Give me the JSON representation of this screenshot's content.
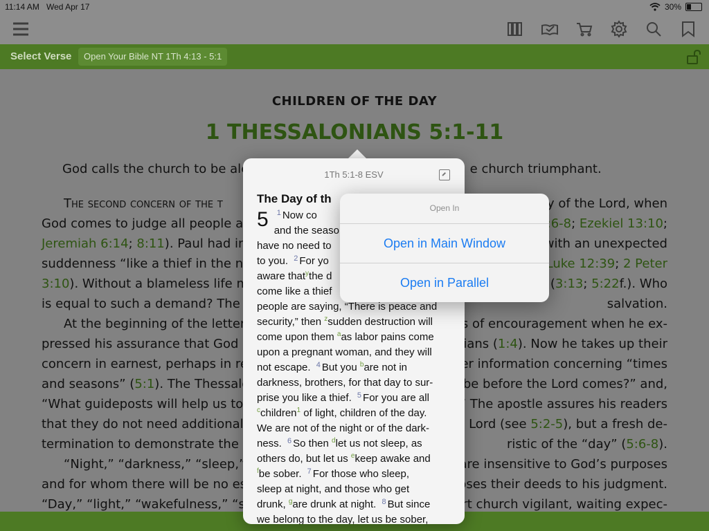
{
  "status": {
    "time": "11:14 AM",
    "date": "Wed Apr 17",
    "battery": "30%",
    "battery_fraction": 0.3
  },
  "toolbar": {
    "icons": [
      "menu-icon",
      "library-icon",
      "reading-plan-icon",
      "cart-icon",
      "gear-icon",
      "search-icon",
      "bookmark-icon"
    ]
  },
  "greenbar": {
    "label": "Select Verse",
    "pill": "Open Your Bible NT 1Th 4:13 - 5:1"
  },
  "content": {
    "kicker": "CHILDREN OF THE DAY",
    "title": "1 THESSALONIANS 5:1-11",
    "intro_left": "God calls the church to be aler",
    "intro_right": "e church triumphant.",
    "p1_lines": [
      [
        "The second concern of the t",
        "y of the Lord, when"
      ],
      [
        "God comes to judge all people a",
        "3:6-8; Ezekiel 13:10;"
      ],
      [
        "Jeremiah 6:14; 8:11). Paul had ins",
        "with an unexpected"
      ],
      [
        "suddenness “like a thief in the ni",
        "Luke 12:39; 2 Peter"
      ],
      [
        "3:10). Without a blameless life me",
        "d (3:13; 5:22f.). Who"
      ],
      [
        "is equal to such a demand? The fa",
        "salvation."
      ]
    ],
    "p2_lines": [
      [
        "At the beginning of the letter P",
        "ds of encouragement when he ex-"
      ],
      [
        "pressed his assurance that God l",
        "ians (1:4). Now he takes up their"
      ],
      [
        "concern in earnest, perhaps in res",
        "er information concerning “times"
      ],
      [
        "and seasons” (5:1). The Thessalo",
        " be before the Lord comes?” and,"
      ],
      [
        "“What guideposts will help us to r",
        "?” The apostle assures his readers"
      ],
      [
        "that they do not need additional",
        "e Lord (see 5:2-5), but a fresh de-"
      ],
      [
        "termination to demonstrate the w",
        "ristic of the “day” (5:6-8)."
      ]
    ],
    "p3_lines": [
      [
        "“Night,” “darkness,” “sleep,” ",
        "are insensitive to God’s purposes"
      ],
      [
        "and for whom there will be no es",
        "oses their deeds to his judgment."
      ],
      [
        "“Day,” “light,” “wakefulness,” “so",
        "rt church vigilant, waiting expec-"
      ]
    ]
  },
  "popover": {
    "title": "1Th 5:1-8 ESV",
    "heading": "The Day of th",
    "chapter": "5",
    "text_html_lines": []
  },
  "openin": {
    "header": "Open In",
    "opt1": "Open in Main Window",
    "opt2": "Open in Parallel"
  },
  "popover_text": [
    {
      "t": "Now co"
    },
    {
      "t": "and the seaso"
    },
    {
      "t": "have no need to"
    },
    {
      "t": "to you."
    },
    {
      "t": "For yo"
    },
    {
      "t": "aware that"
    },
    {
      "t": "the d"
    },
    {
      "t": "come like a thief"
    },
    {
      "t": "people are saying, “There is peace and"
    },
    {
      "t": "security,” then"
    },
    {
      "t": "sudden destruction will"
    },
    {
      "t": "come upon them"
    },
    {
      "t": "as labor pains come"
    },
    {
      "t": "upon a pregnant woman, and they will"
    },
    {
      "t": "not escape."
    },
    {
      "t": "But you"
    },
    {
      "t": "are not in"
    },
    {
      "t": "darkness, brothers, for that day to sur-"
    },
    {
      "t": "prise you like a thief."
    },
    {
      "t": "For you are all"
    },
    {
      "t": "children"
    },
    {
      "t": "of light, children of the day."
    },
    {
      "t": "We are not of the night or of the dark-"
    },
    {
      "t": "ness."
    },
    {
      "t": "So then"
    },
    {
      "t": "let us not sleep, as"
    },
    {
      "t": "others do, but let us"
    },
    {
      "t": "keep awake and"
    },
    {
      "t": "be sober."
    },
    {
      "t": "For those who sleep,"
    },
    {
      "t": "sleep at night, and those who get"
    },
    {
      "t": "drunk,"
    },
    {
      "t": "are drunk at night."
    },
    {
      "t": "But since"
    },
    {
      "t": "we belong to the day, let us be sober,"
    }
  ],
  "popover_marks": {
    "v1": "1",
    "v2": "2",
    "v3": "3",
    "v4": "4",
    "v5": "5",
    "v6": "6",
    "v7": "7",
    "v8": "8",
    "fy": "y",
    "fz": "z",
    "fa": "a",
    "fb": "b",
    "fc": "c",
    "f1": "1",
    "fd": "d",
    "fe": "e",
    "ff": "f",
    "fg": "g"
  }
}
